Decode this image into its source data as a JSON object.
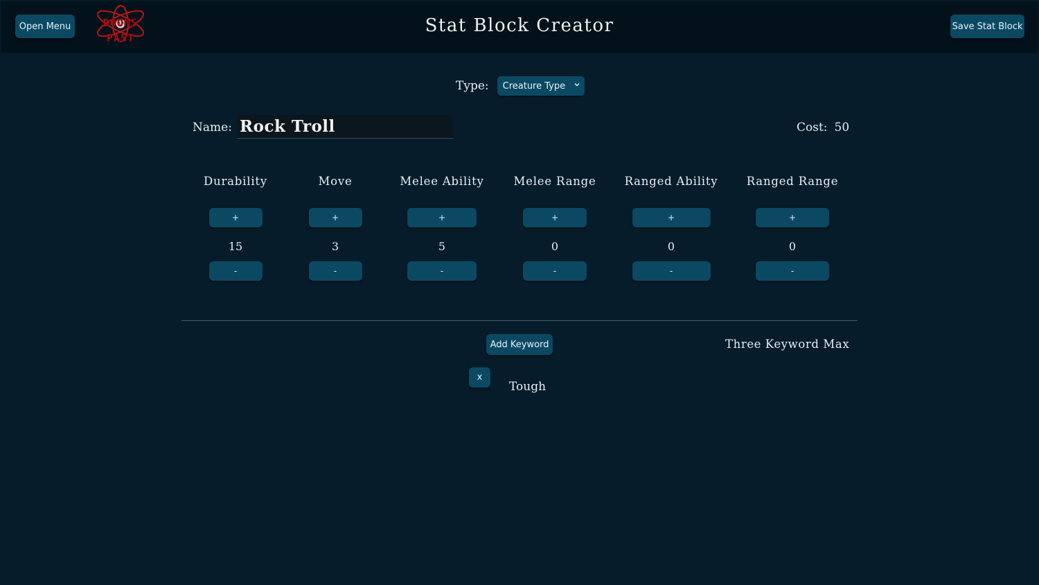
{
  "header": {
    "open_menu_label": "Open Menu",
    "title": "Stat Block Creator",
    "save_label": "Save Stat Block",
    "logo_text_top": "DOOMS",
    "logo_text_bottom": "PAST"
  },
  "type_select": {
    "label": "Type:",
    "value": "Creature Type"
  },
  "name_field": {
    "label": "Name:",
    "value": "Rock Troll"
  },
  "cost": {
    "label": "Cost:",
    "value": "50"
  },
  "stats": [
    {
      "label": "Durability",
      "value": "15",
      "plus": "+",
      "minus": "-"
    },
    {
      "label": "Move",
      "value": "3",
      "plus": "+",
      "minus": "-"
    },
    {
      "label": "Melee Ability",
      "value": "5",
      "plus": "+",
      "minus": "-"
    },
    {
      "label": "Melee Range",
      "value": "0",
      "plus": "+",
      "minus": "-"
    },
    {
      "label": "Ranged Ability",
      "value": "0",
      "plus": "+",
      "minus": "-"
    },
    {
      "label": "Ranged Range",
      "value": "0",
      "plus": "+",
      "minus": "-"
    }
  ],
  "keywords": {
    "add_label": "Add Keyword",
    "max_note": "Three Keyword Max",
    "items": [
      {
        "remove_label": "x",
        "text": "Tough"
      }
    ]
  },
  "colors": {
    "background": "#061c2b",
    "topbar": "#03111a",
    "button": "#0b4963",
    "logo_red": "#c0141b"
  }
}
